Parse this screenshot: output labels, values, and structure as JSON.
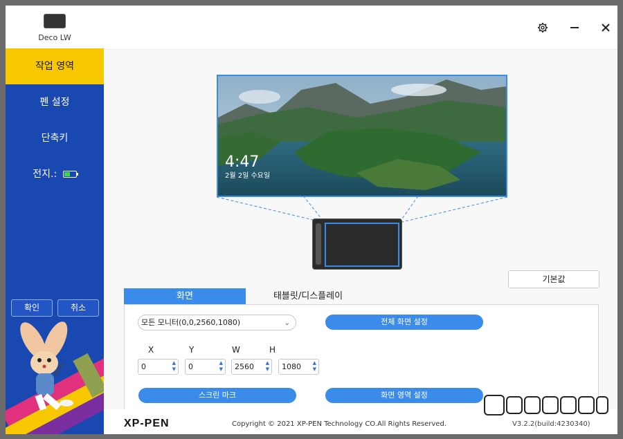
{
  "device": {
    "name": "Deco LW"
  },
  "sidebar": {
    "items": [
      {
        "label": "작업 영역",
        "active": true
      },
      {
        "label": "펜 설정"
      },
      {
        "label": "단축키"
      },
      {
        "label": "전지.:",
        "icon": "battery-icon"
      }
    ],
    "confirm_label": "확인",
    "cancel_label": "취소"
  },
  "topbar": {
    "icons": [
      "gear-icon",
      "minimize-icon",
      "close-icon"
    ]
  },
  "preview": {
    "time": "4:47",
    "date": "2월 2일 수요일"
  },
  "buttons": {
    "default_label": "기본값",
    "fullscreen_label": "전체 화면 설정",
    "screen_mark_label": "스크린 마크",
    "screen_area_label": "화면 영역 설정"
  },
  "tabs": [
    {
      "label": "화면",
      "active": true
    },
    {
      "label": "태블릿/디스플레이"
    }
  ],
  "monitor_select": {
    "value": "모든 모니터(0,0,2560,1080)"
  },
  "coords": {
    "labels": [
      "X",
      "Y",
      "W",
      "H"
    ],
    "values": [
      "0",
      "0",
      "2560",
      "1080"
    ]
  },
  "footer": {
    "logo": "XP-PEN",
    "copyright": "Copyright © 2021 XP-PEN Technology CO.All Rights Reserved.",
    "version": "V3.2.2(build:4230340)"
  },
  "colors": {
    "accent": "#3a8bea",
    "sidebar": "#1948b0",
    "active_nav": "#f7c800"
  }
}
